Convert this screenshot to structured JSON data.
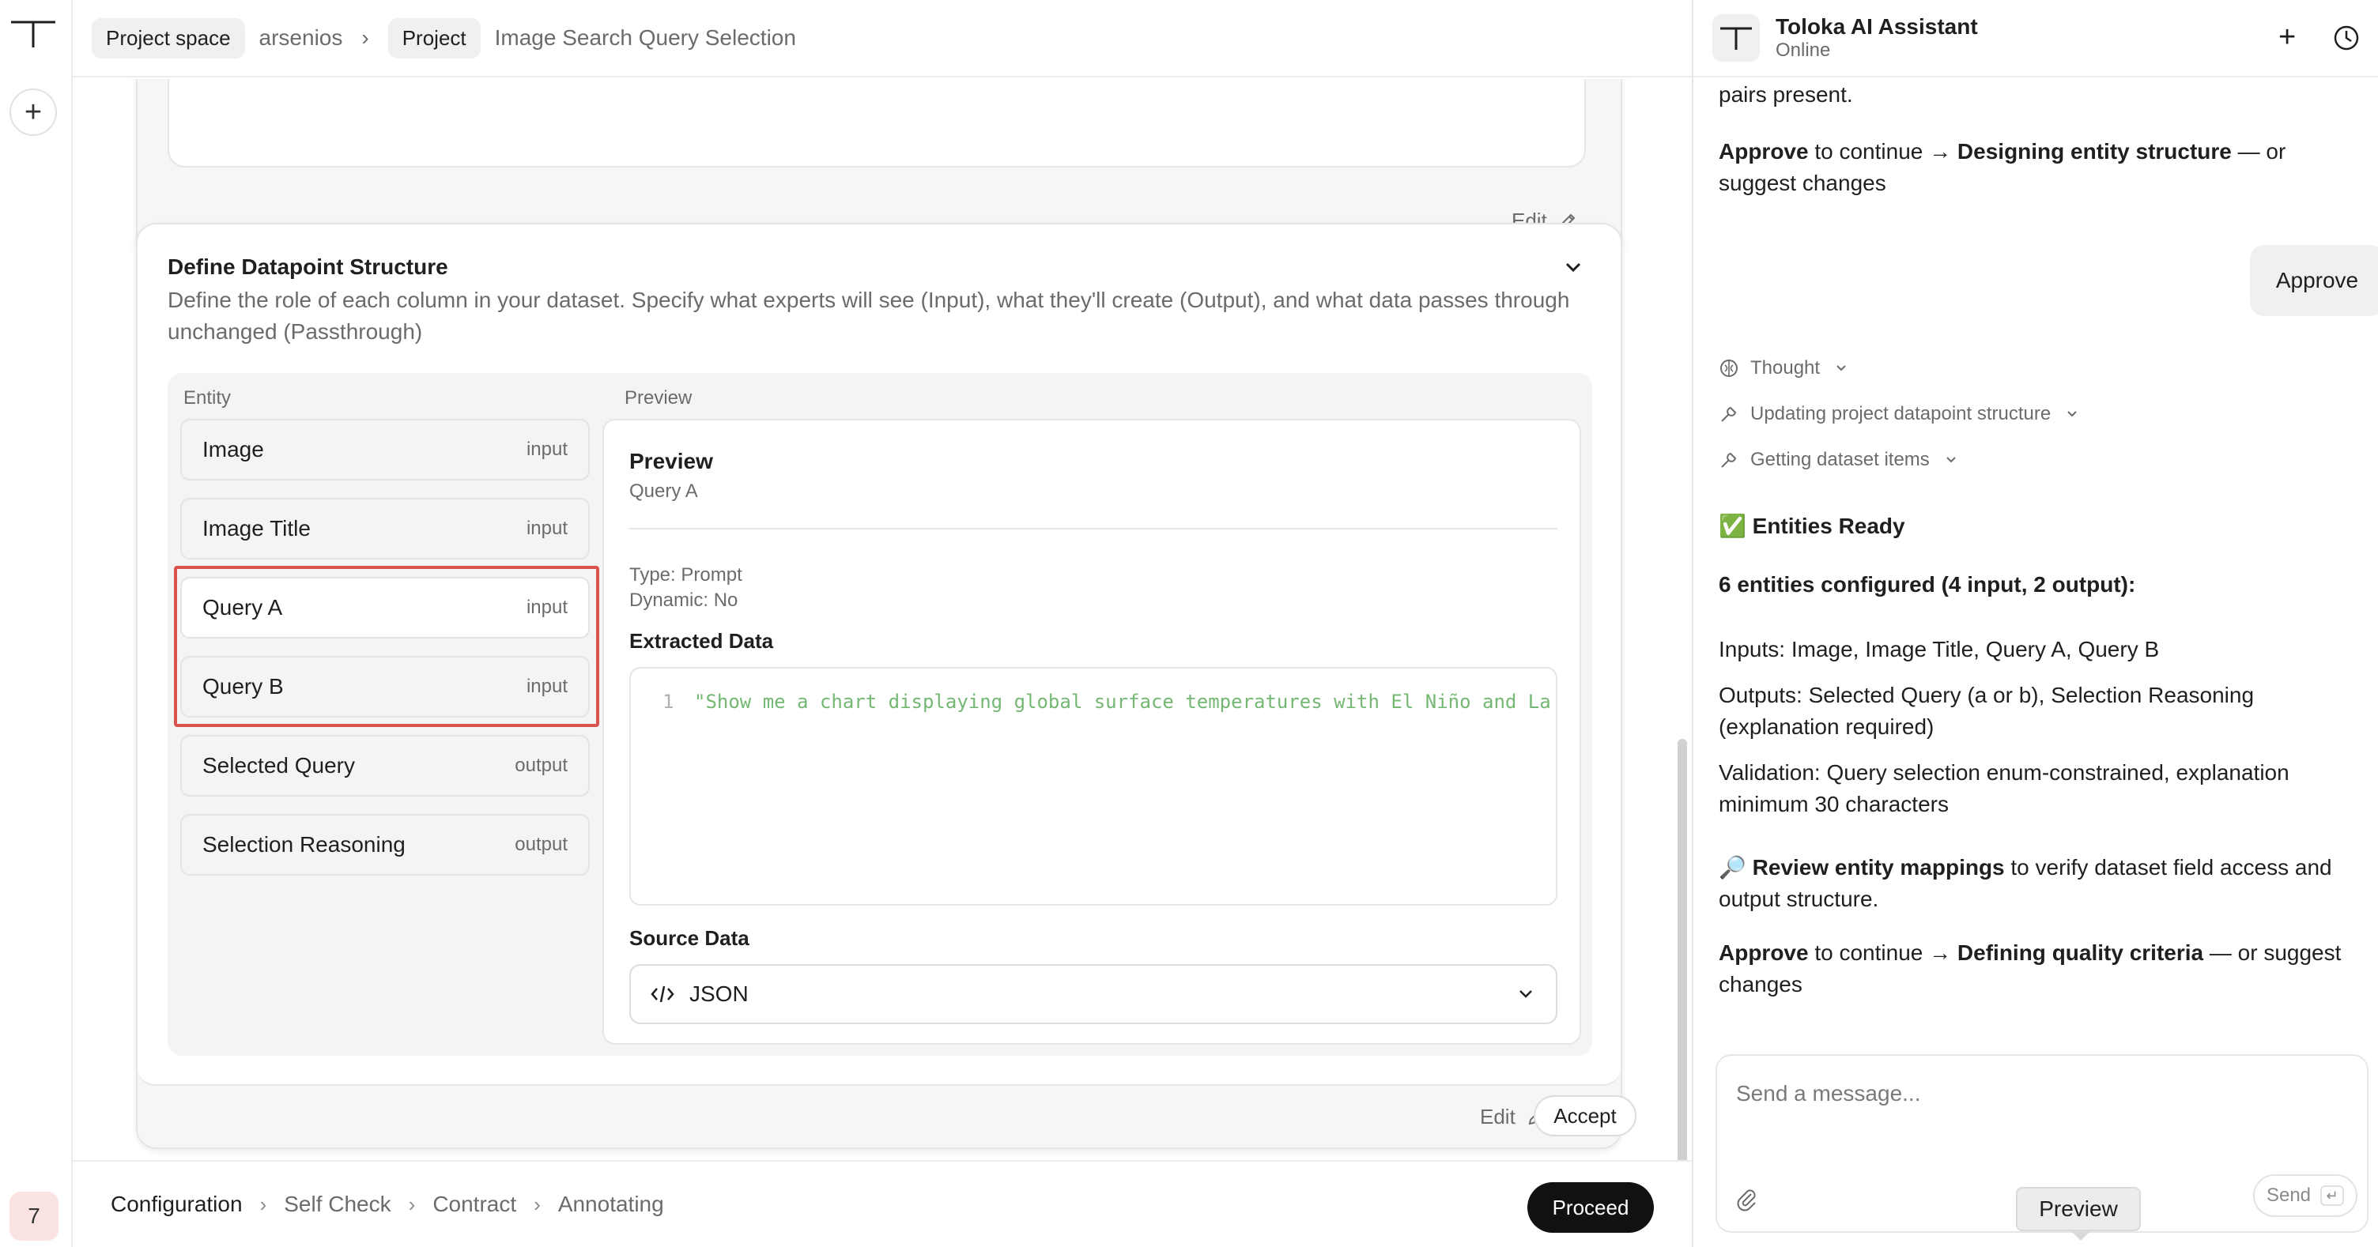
{
  "breadcrumb": {
    "project_space_chip": "Project space",
    "workspace": "arsenios",
    "separator": "›",
    "project_chip": "Project",
    "project_name": "Image Search Query Selection"
  },
  "rail": {
    "logo_icon": "toloka-logo-icon",
    "add_icon": "plus-icon",
    "badge": "7"
  },
  "card1": {
    "edit_label": "Edit"
  },
  "datapoint": {
    "title": "Define Datapoint Structure",
    "description": "Define the role of each column in your dataset. Specify what experts will see (Input), what they'll create (Output), and what data passes through unchanged (Passthrough)",
    "entity_header": "Entity",
    "preview_header": "Preview",
    "entities": [
      {
        "name": "Image",
        "type": "input"
      },
      {
        "name": "Image Title",
        "type": "input"
      },
      {
        "name": "Query A",
        "type": "input"
      },
      {
        "name": "Query B",
        "type": "input"
      },
      {
        "name": "Selected Query",
        "type": "output"
      },
      {
        "name": "Selection Reasoning",
        "type": "output"
      }
    ],
    "preview": {
      "title": "Preview",
      "subtitle": "Query A",
      "type_label": "Type:",
      "type_value": "Prompt",
      "dynamic_label": "Dynamic:",
      "dynamic_value": "No",
      "extracted_label": "Extracted Data",
      "code_line_number": "1",
      "code_text": "\"Show me a chart displaying global surface temperatures with El Niño and La",
      "source_label": "Source Data",
      "source_value": "JSON"
    },
    "edit_label": "Edit",
    "accept_label": "Accept"
  },
  "steps": {
    "items": [
      "Configuration",
      "Self Check",
      "Contract",
      "Annotating"
    ],
    "active": "Configuration",
    "separator": "›",
    "proceed_label": "Proceed"
  },
  "assistant": {
    "name": "Toloka AI Assistant",
    "status": "Online",
    "msg_top": "pairs present.",
    "approve1_prefix": "Approve",
    "approve1_mid": " to continue → ",
    "approve1_target": "Designing entity structure",
    "approve1_suffix": " — or suggest changes",
    "user_bubble": "Approve",
    "steps": [
      {
        "icon": "brain-icon",
        "label": "Thought"
      },
      {
        "icon": "wrench-icon",
        "label": "Updating project datapoint structure"
      },
      {
        "icon": "wrench-icon",
        "label": "Getting dataset items"
      }
    ],
    "ready_emoji": "✅",
    "ready_title": "Entities Ready",
    "configured": "6 entities configured (4 input, 2 output):",
    "inputs": "Inputs: Image, Image Title, Query A, Query B",
    "outputs": "Outputs: Selected Query (a or b), Selection Reasoning (explanation required)",
    "validation": "Validation: Query selection enum-constrained, explanation minimum 30 characters",
    "review_emoji": "🔎",
    "review_bold": "Review entity mappings",
    "review_rest": " to verify dataset field access and output structure.",
    "approve2_prefix": "Approve",
    "approve2_mid": " to continue → ",
    "approve2_target": "Defining quality criteria",
    "approve2_suffix": " — or suggest changes",
    "input_placeholder": "Send a message...",
    "send_label": "Send",
    "enter_glyph": "↵",
    "tooltip": "Preview"
  },
  "colors": {
    "accent_dark": "#111111",
    "highlight_red": "#d9534f",
    "code_green": "#74b874"
  }
}
